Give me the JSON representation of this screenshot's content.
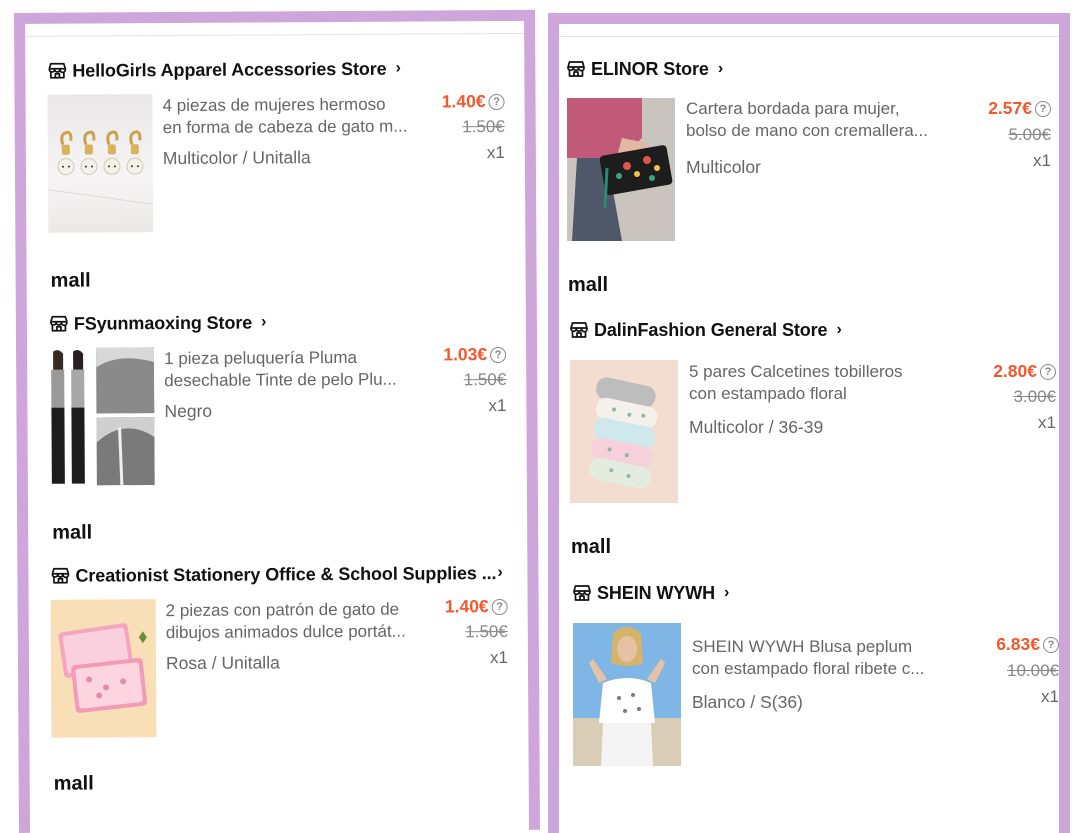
{
  "colors": {
    "frame": "#cfa6dc",
    "price": "#f2592c",
    "secondary_text": "#666666"
  },
  "icons": {
    "store": "store-icon",
    "chevron": "chevron-right-icon",
    "help": "question-circle-icon"
  },
  "left_column": {
    "stores": [
      {
        "name": "HelloGirls Apparel Accessories Store",
        "product": {
          "title_line1": "4 piezas de mujeres hermoso",
          "title_line2": "en forma de cabeza de gato m...",
          "variant": "Multicolor / Unitalla",
          "price": "1.40€",
          "original_price": "1.50€",
          "quantity": "x1"
        },
        "mall_label": "mall"
      },
      {
        "name": "FSyunmaoxing Store",
        "product": {
          "title_line1": "1 pieza peluquería Pluma",
          "title_line2": "desechable Tinte de pelo Plu...",
          "variant": "Negro",
          "price": "1.03€",
          "original_price": "1.50€",
          "quantity": "x1"
        },
        "mall_label": "mall"
      },
      {
        "name": "Creationist Stationery Office & School Supplies ...",
        "product": {
          "title_line1": "2 piezas con patrón de gato de",
          "title_line2": "dibujos animados dulce portát...",
          "variant": "Rosa / Unitalla",
          "price": "1.40€",
          "original_price": "1.50€",
          "quantity": "x1"
        },
        "mall_label": "mall"
      }
    ]
  },
  "right_column": {
    "stores": [
      {
        "name": "ELINOR Store",
        "product": {
          "title_line1": "Cartera bordada para mujer,",
          "title_line2": "bolso de mano con cremallera...",
          "variant": "Multicolor",
          "price": "2.57€",
          "original_price": "5.00€",
          "quantity": "x1"
        },
        "mall_label": "mall"
      },
      {
        "name": "DalinFashion General Store",
        "product": {
          "title_line1": "5 pares Calcetines tobilleros",
          "title_line2": "con estampado floral",
          "variant": "Multicolor / 36-39",
          "price": "2.80€",
          "original_price": "3.00€",
          "quantity": "x1"
        },
        "mall_label": "mall"
      },
      {
        "name": "SHEIN WYWH",
        "product": {
          "title_line1": "SHEIN WYWH Blusa peplum",
          "title_line2": "con estampado floral ribete c...",
          "variant": "Blanco / S(36)",
          "price": "6.83€",
          "original_price": "10.00€",
          "quantity": "x1"
        }
      }
    ]
  }
}
